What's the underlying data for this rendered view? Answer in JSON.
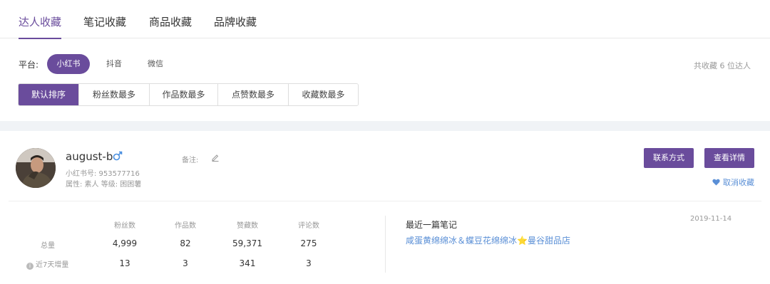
{
  "tabs": [
    {
      "label": "达人收藏"
    },
    {
      "label": "笔记收藏"
    },
    {
      "label": "商品收藏"
    },
    {
      "label": "品牌收藏"
    }
  ],
  "filter": {
    "platform_label": "平台:",
    "platforms": [
      {
        "label": "小红书"
      },
      {
        "label": "抖音"
      },
      {
        "label": "微信"
      }
    ],
    "total_text": "共收藏 6 位达人",
    "sort_options": [
      {
        "label": "默认排序"
      },
      {
        "label": "粉丝数最多"
      },
      {
        "label": "作品数最多"
      },
      {
        "label": "点赞数最多"
      },
      {
        "label": "收藏数最多"
      }
    ]
  },
  "card": {
    "username": "august-b",
    "xhs_id": "小红书号: 953577716",
    "attributes": "属性: 素人  等级: 困困薯",
    "remark_label": "备注:",
    "contact_button": "联系方式",
    "details_button": "查看详情",
    "unfavorite": "取消收藏",
    "stats": {
      "headers": [
        "粉丝数",
        "作品数",
        "赞藏数",
        "评论数"
      ],
      "rows": [
        {
          "label": "总量",
          "values": [
            "4,999",
            "82",
            "59,371",
            "275"
          ]
        },
        {
          "label": "近7天增量",
          "values": [
            "13",
            "3",
            "341",
            "3"
          ]
        }
      ]
    },
    "recent_note": {
      "title": "最近一篇笔记",
      "link_text": "咸蛋黄绵绵冰＆蝶豆花绵绵冰⭐曼谷甜品店",
      "date": "2019-11-14"
    }
  },
  "colors": {
    "accent": "#6a4c9c",
    "link": "#5a8fd6",
    "male": "#4a8fe0"
  }
}
